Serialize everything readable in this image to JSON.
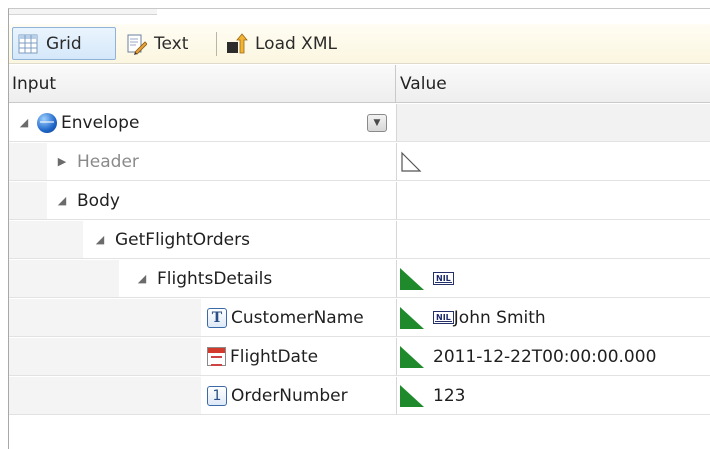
{
  "toolbar": {
    "grid_label": "Grid",
    "text_label": "Text",
    "load_label": "Load XML",
    "grid_icon": "grid-view-icon",
    "text_icon": "text-edit-icon",
    "load_icon": "load-xml-icon"
  },
  "columns": {
    "input": "Input",
    "value": "Value"
  },
  "tree": {
    "envelope": {
      "label": "Envelope",
      "icon": "globe-icon",
      "expanded": true
    },
    "header": {
      "label": "Header",
      "expanded": false
    },
    "body": {
      "label": "Body",
      "expanded": true
    },
    "get_flight_orders": {
      "label": "GetFlightOrders",
      "expanded": true
    },
    "flights_details": {
      "label": "FlightsDetails",
      "expanded": true,
      "nil": "NIL"
    },
    "customer_name": {
      "label": "CustomerName",
      "type_icon": "T",
      "nil": "NIL",
      "value": "John Smith"
    },
    "flight_date": {
      "label": "FlightDate",
      "type_icon": "calendar-icon",
      "value": "2011-12-22T00:00:00.000"
    },
    "order_number": {
      "label": "OrderNumber",
      "type_icon": "1",
      "value": "123"
    }
  },
  "colors": {
    "accent_flag": "#1f8a2b",
    "toolbar_bg": "#fbf6e0",
    "selected_tab": "#d5e8fa"
  }
}
